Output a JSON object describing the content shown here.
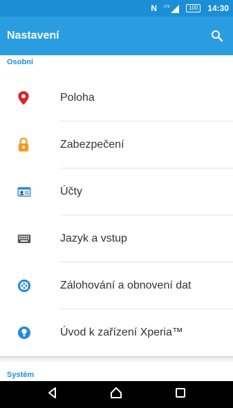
{
  "status_bar": {
    "nfc": "N",
    "network": "LTE",
    "battery": "100",
    "time": "14:30"
  },
  "app_bar": {
    "title": "Nastavení",
    "search_icon": "search-icon"
  },
  "sections": {
    "personal": "Osobní",
    "system": "Systém"
  },
  "items": [
    {
      "label": "Poloha",
      "icon": "location-pin-icon",
      "color": "#d9252b"
    },
    {
      "label": "Zabezpečení",
      "icon": "lock-icon",
      "color": "#f39c1b"
    },
    {
      "label": "Účty",
      "icon": "account-card-icon",
      "color": "#2a8ad6"
    },
    {
      "label": "Jazyk a vstup",
      "icon": "keyboard-icon",
      "color": "#444444"
    },
    {
      "label": "Zálohování a obnovení dat",
      "icon": "backup-restore-icon",
      "color": "#2a8ad6"
    },
    {
      "label": "Úvod k zařízení Xperia™",
      "icon": "xperia-info-icon",
      "color": "#2a8ad6"
    }
  ],
  "navigation": {
    "back": "back-icon",
    "home": "home-icon",
    "recent": "recent-apps-icon"
  },
  "colors": {
    "status_bar": "#1b8fd6",
    "app_bar": "#2a9de0",
    "section_header": "#1f8fd8",
    "nav_bar": "#000000"
  }
}
